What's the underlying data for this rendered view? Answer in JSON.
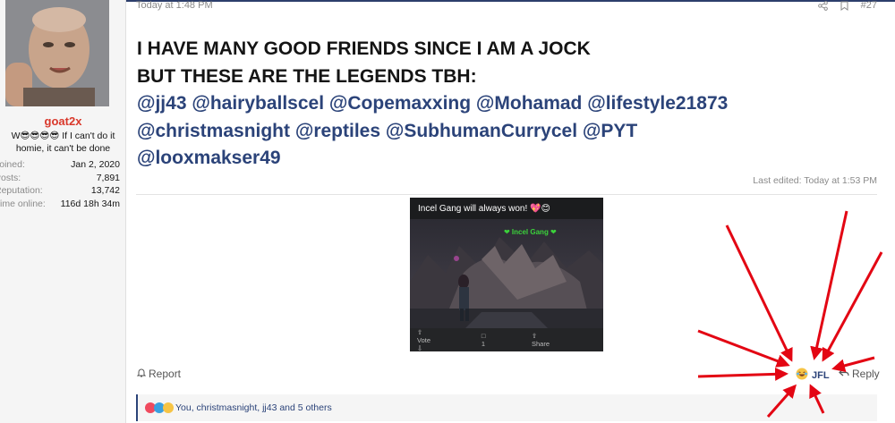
{
  "user": {
    "username": "goat2x",
    "title": "W😎😎😎😎 If I can't do it homie, it can't be done",
    "stats": [
      {
        "label": "Joined:",
        "value": "Jan 2, 2020"
      },
      {
        "label": "Posts:",
        "value": "7,891"
      },
      {
        "label": "Reputation:",
        "value": "13,742"
      },
      {
        "label": "Time online:",
        "value": "116d 18h 34m"
      }
    ]
  },
  "post": {
    "time": "Today at 1:48 PM",
    "number": "#27",
    "line1": "I HAVE MANY GOOD FRIENDS SINCE I AM A JOCK",
    "line2": "BUT THESE ARE THE LEGENDS TBH:",
    "mentions_line1": "@jj43 @hairyballscel @Copemaxxing @Mohamad @lifestyle21873",
    "mentions_line2": "@christmasnight @reptiles @SubhumanCurrycel @PYT",
    "mentions_line3": "@looxmakser49",
    "last_edited": "Last edited: Today at 1:53 PM"
  },
  "embed": {
    "caption": "Incel Gang will always won! 💖😊",
    "label": "❤ Incel Gang ❤",
    "vote": "Vote",
    "comments": "1",
    "share": "Share"
  },
  "actions": {
    "report": "Report",
    "react": "JFL",
    "reply": "Reply"
  },
  "reactions": {
    "summary": "You, christmasnight, jj43 and 5 others"
  },
  "colors": {
    "accent": "#2b4379",
    "username": "#d9382b",
    "arrow": "#e30613"
  }
}
